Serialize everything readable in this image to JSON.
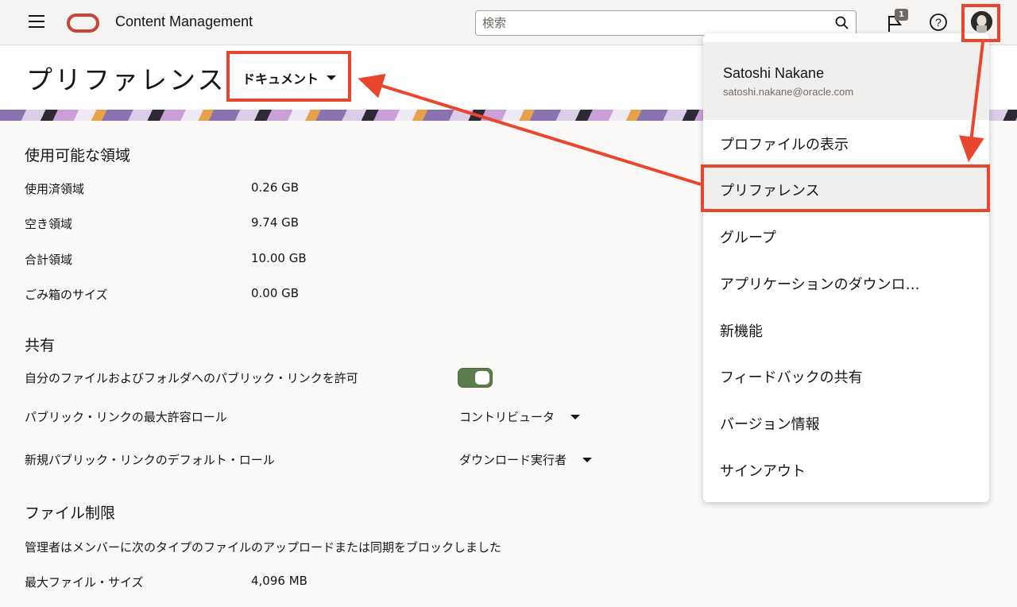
{
  "header": {
    "app_title": "Content Management",
    "search_placeholder": "検索",
    "notification_count": "1",
    "icons": [
      "hamburger-icon",
      "oracle-logo",
      "search-icon",
      "flag-icon",
      "help-icon",
      "avatar"
    ]
  },
  "page": {
    "title": "プリファレンス",
    "section_dropdown": "ドキュメント"
  },
  "storage": {
    "title": "使用可能な領域",
    "rows": [
      {
        "label": "使用済領域",
        "value": "0.26 GB"
      },
      {
        "label": "空き領域",
        "value": "9.74 GB"
      },
      {
        "label": "合計領域",
        "value": "10.00 GB"
      },
      {
        "label": "ごみ箱のサイズ",
        "value": "0.00 GB"
      }
    ]
  },
  "sharing": {
    "title": "共有",
    "allow_public_links_label": "自分のファイルおよびフォルダへのパブリック・リンクを許可",
    "allow_public_links_on": true,
    "max_role_label": "パブリック・リンクの最大許容ロール",
    "max_role_value": "コントリビュータ",
    "default_role_label": "新規パブリック・リンクのデフォルト・ロール",
    "default_role_value": "ダウンロード実行者"
  },
  "file_limits": {
    "title": "ファイル制限",
    "blocked_text": "管理者はメンバーに次のタイプのファイルのアップロードまたは同期をブロックしました",
    "max_size_label": "最大ファイル・サイズ",
    "max_size_value": "4,096 MB"
  },
  "user_menu": {
    "name": "Satoshi Nakane",
    "email": "satoshi.nakane@oracle.com",
    "items": [
      "プロファイルの表示",
      "プリファレンス",
      "グループ",
      "アプリケーションのダウンロ…",
      "新機能",
      "フィードバックの共有",
      "バージョン情報",
      "サインアウト"
    ],
    "active_item": "プリファレンス"
  },
  "colors": {
    "accent_red": "#e8472d",
    "oracle_red": "#c74634",
    "toggle_green": "#5b7d4c"
  }
}
